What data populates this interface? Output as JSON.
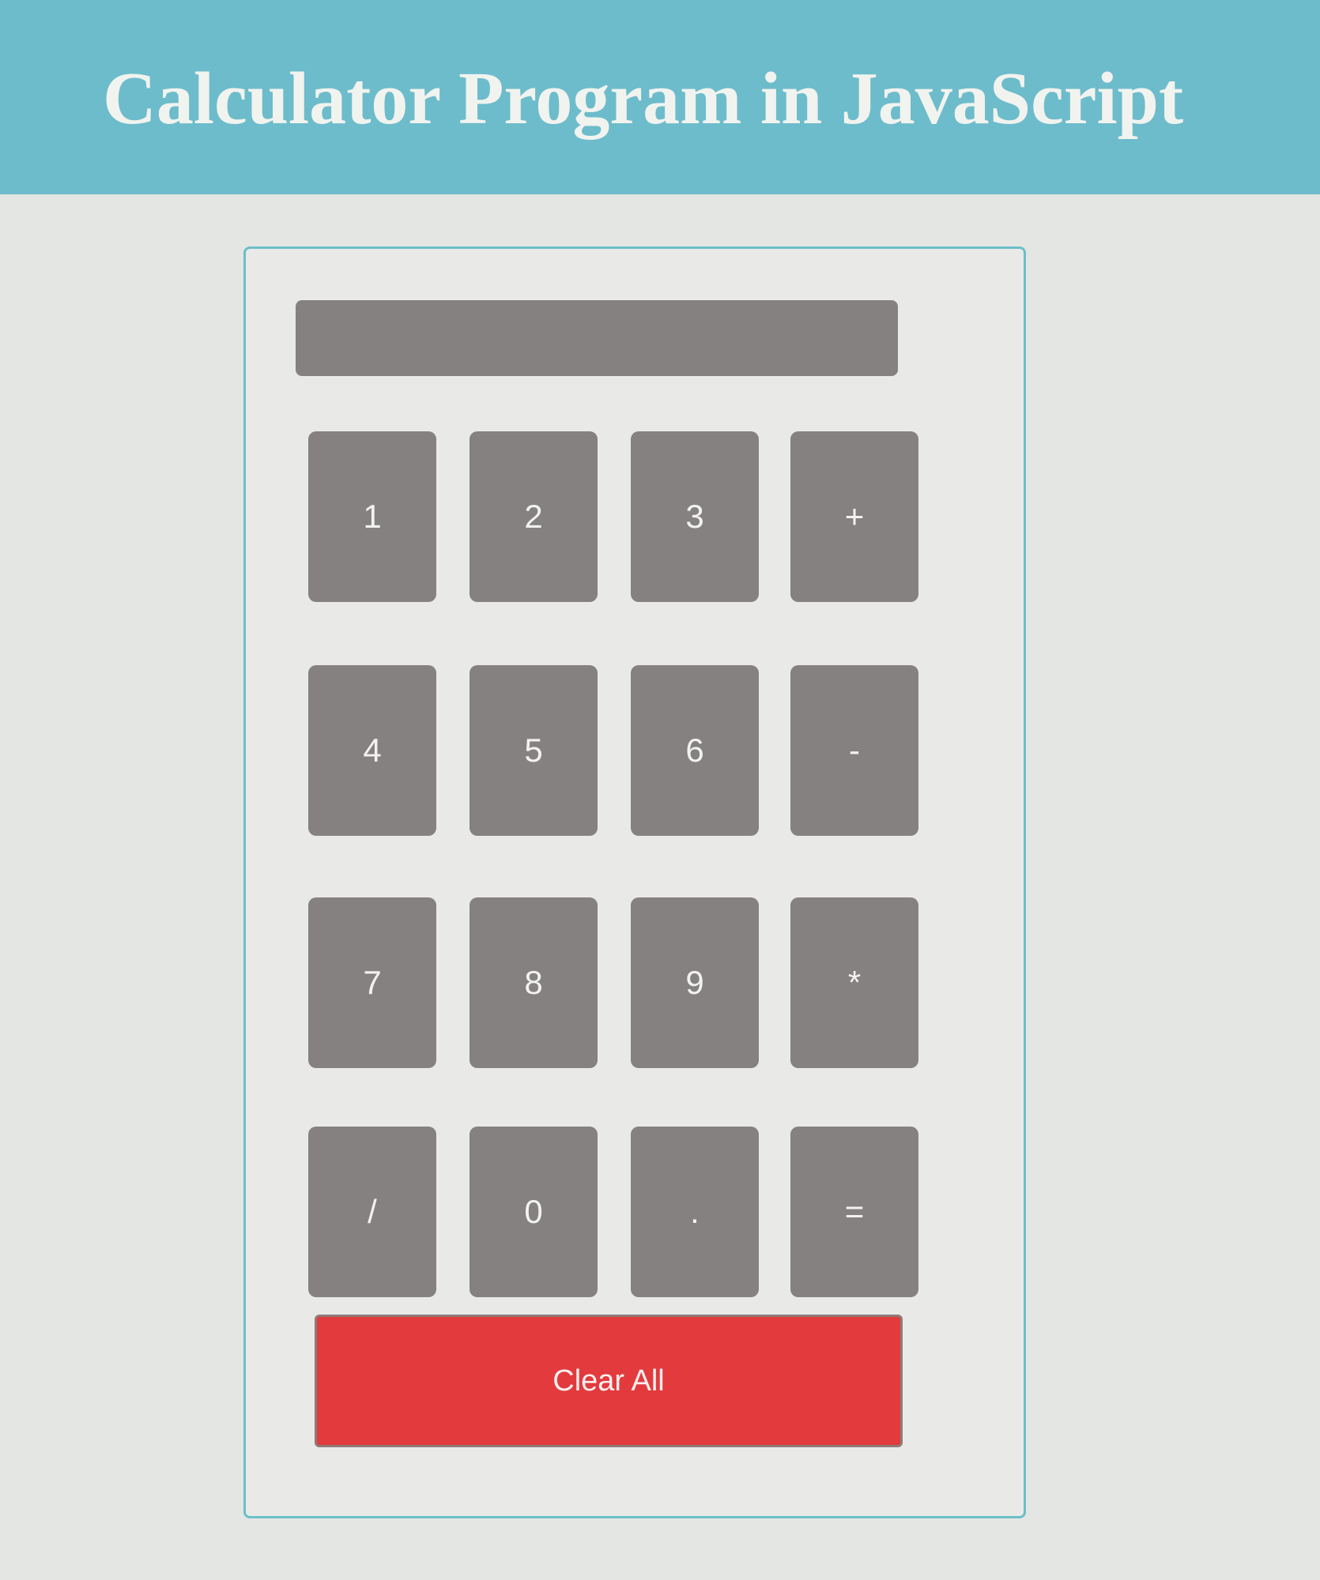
{
  "header": {
    "title": "Calculator Program in JavaScript"
  },
  "calculator": {
    "display_value": "",
    "keys": [
      {
        "label": "1",
        "name": "key-1"
      },
      {
        "label": "2",
        "name": "key-2"
      },
      {
        "label": "3",
        "name": "key-3"
      },
      {
        "label": "+",
        "name": "key-plus"
      },
      {
        "label": "4",
        "name": "key-4"
      },
      {
        "label": "5",
        "name": "key-5"
      },
      {
        "label": "6",
        "name": "key-6"
      },
      {
        "label": "-",
        "name": "key-minus"
      },
      {
        "label": "7",
        "name": "key-7"
      },
      {
        "label": "8",
        "name": "key-8"
      },
      {
        "label": "9",
        "name": "key-9"
      },
      {
        "label": "*",
        "name": "key-multiply"
      },
      {
        "label": "/",
        "name": "key-divide"
      },
      {
        "label": "0",
        "name": "key-0"
      },
      {
        "label": ".",
        "name": "key-decimal"
      },
      {
        "label": "=",
        "name": "key-equals"
      }
    ],
    "clear_label": "Clear All"
  },
  "colors": {
    "header_bg": "#6dbccb",
    "key_bg": "#858180",
    "clear_bg": "#e23a3d",
    "border_accent": "#6bbfc9"
  }
}
